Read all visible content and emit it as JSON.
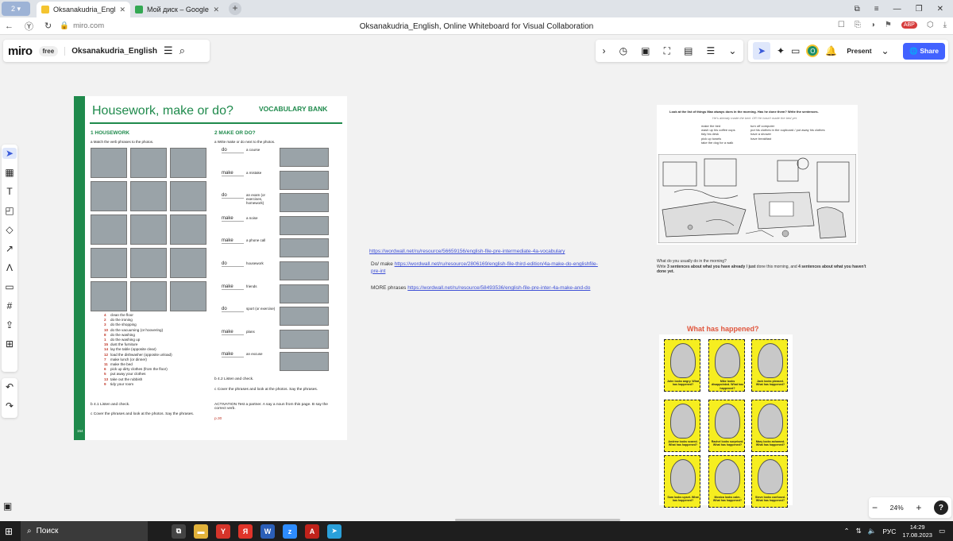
{
  "browser": {
    "tab_count": "2",
    "tabs": [
      {
        "label": "Oksanakudria_English, C",
        "fav_color": "#f4c430"
      },
      {
        "label": "Мой диск – Google Диск",
        "fav_color": "#34a853"
      }
    ],
    "url": "miro.com",
    "page_title": "Oksanakudria_English, Online Whiteboard for Visual Collaboration",
    "adblock_label": "ABP"
  },
  "miro": {
    "logo": "miro",
    "plan_badge": "free",
    "board_name": "Oksanakudria_English",
    "user_initial": "O",
    "present_label": "Present",
    "share_label": "Share",
    "zoom_level": "24%",
    "help_label": "?"
  },
  "worksheet": {
    "title": "Housework, make or do?",
    "bank": "VOCABULARY BANK",
    "sec1": "1  HOUSEWORK",
    "sec1a": "a   Match the verb phrases to the photos.",
    "sec2": "2  MAKE OR DO?",
    "sec2a": "a   Write make or do next to the photos.",
    "vocab": [
      {
        "n": "4",
        "t": "clean the floor"
      },
      {
        "n": "2",
        "t": "do the ironing"
      },
      {
        "n": "3",
        "t": "do the shopping"
      },
      {
        "n": "10",
        "t": "do the vacuuming (or hoovering)"
      },
      {
        "n": "8",
        "t": "do the washing"
      },
      {
        "n": "1",
        "t": "do the washing up"
      },
      {
        "n": "15",
        "t": "dust the furniture"
      },
      {
        "n": "14",
        "t": "lay the table (opposite clear)"
      },
      {
        "n": "12",
        "t": "load the dishwasher (opposite unload)"
      },
      {
        "n": "7",
        "t": "make lunch (or dinner)"
      },
      {
        "n": "11",
        "t": "make the bed"
      },
      {
        "n": "6",
        "t": "pick up dirty clothes (from the floor)"
      },
      {
        "n": "5",
        "t": "put away your clothes"
      },
      {
        "n": "13",
        "t": "take out the rubbish"
      },
      {
        "n": "9",
        "t": "tidy your room"
      }
    ],
    "make_rows": [
      {
        "ans": "do",
        "txt": "a course"
      },
      {
        "ans": "make",
        "txt": "a mistake"
      },
      {
        "ans": "do",
        "txt": "an exam (or exercises, homework)"
      },
      {
        "ans": "make",
        "txt": "a noise"
      },
      {
        "ans": "make",
        "txt": "a phone call"
      },
      {
        "ans": "do",
        "txt": "housework"
      },
      {
        "ans": "make",
        "txt": "friends"
      },
      {
        "ans": "do",
        "txt": "sport (or exercise)"
      },
      {
        "ans": "make",
        "txt": "plans"
      },
      {
        "ans": "make",
        "txt": "an excuse"
      }
    ],
    "b1": "b   4.1  Listen and check.",
    "c1": "c   Cover the phrases and look at the photos. Say the phrases.",
    "b2": "b   4.2  Listen and check.",
    "c2": "c   Cover the phrases and look at the photos. Say the phrases.",
    "activation": "ACTIVATION  Test a partner. A say a noun from this page. B say the correct verb.",
    "page_ref": "p.30",
    "page_number": "154"
  },
  "links": {
    "l1": "https://wordwall.net/ru/resource/56659156/english-file-pre-intermediate-4a-vocabulary",
    "l2_prefix": "Do/ make ",
    "l2": "https://wordwall.net/ru/resource/2806169/english-file-third-edition/4a-make-do-englishfile-pre-int",
    "l3_prefix": "MORE phrases ",
    "l3": "https://wordwall.net/ru/resource/58493536/english-file-pre-inter-4a-make-and-do"
  },
  "room": {
    "intro": "Look at the list of things Max always does in the morning. Has he done them? Write the sentences.",
    "hint": "He's already made the bed. OR He hasn't made the bed yet.",
    "col1": [
      "make the bed",
      "wash up his coffee cups",
      "tidy his desk",
      "pick up towels",
      "take the dog for a walk"
    ],
    "col2": [
      "turn off computer",
      "put his clothes in the cupboard / put away his clothes",
      "have a shower",
      "have breakfast"
    ],
    "q1": "What do you usually do in the morning?",
    "q2_pre": "Write ",
    "q2_b1": "3 sentences about what you have already / just",
    "q2_mid": " done this morning, and ",
    "q2_b2": "4 sentences about what you haven't done yet."
  },
  "happened": {
    "title": "What has happened?",
    "cards": [
      "John looks angry. What has happened?",
      "Mike looks disappointed. What has happened?",
      "Jack looks pleased. What has happened?",
      "Andrew looks scared. What has happened?",
      "Rachel looks surprised. What has happened?",
      "Mary looks ashamed. What has happened?",
      "Sam looks upset. What has happened?",
      "Monica looks calm. What has happened?",
      "Steve looks confused. What has happened?"
    ]
  },
  "taskbar": {
    "search_label": "Поиск",
    "lang": "РУС",
    "time": "14:29",
    "date": "17.08.2023"
  }
}
